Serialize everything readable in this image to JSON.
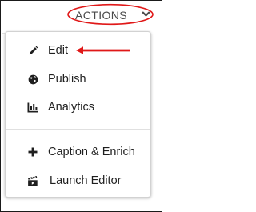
{
  "header": {
    "actions_label": "ACTIONS"
  },
  "menu": {
    "items": [
      {
        "label": "Edit",
        "icon": "pencil-icon"
      },
      {
        "label": "Publish",
        "icon": "globe-icon"
      },
      {
        "label": "Analytics",
        "icon": "bar-chart-icon"
      },
      {
        "label": "Caption & Enrich",
        "icon": "plus-icon"
      },
      {
        "label": "Launch Editor",
        "icon": "clapperboard-icon"
      }
    ]
  },
  "colors": {
    "annotation": "#e01818",
    "text": "#1f1f1f",
    "header_text": "#4a4a4a"
  }
}
